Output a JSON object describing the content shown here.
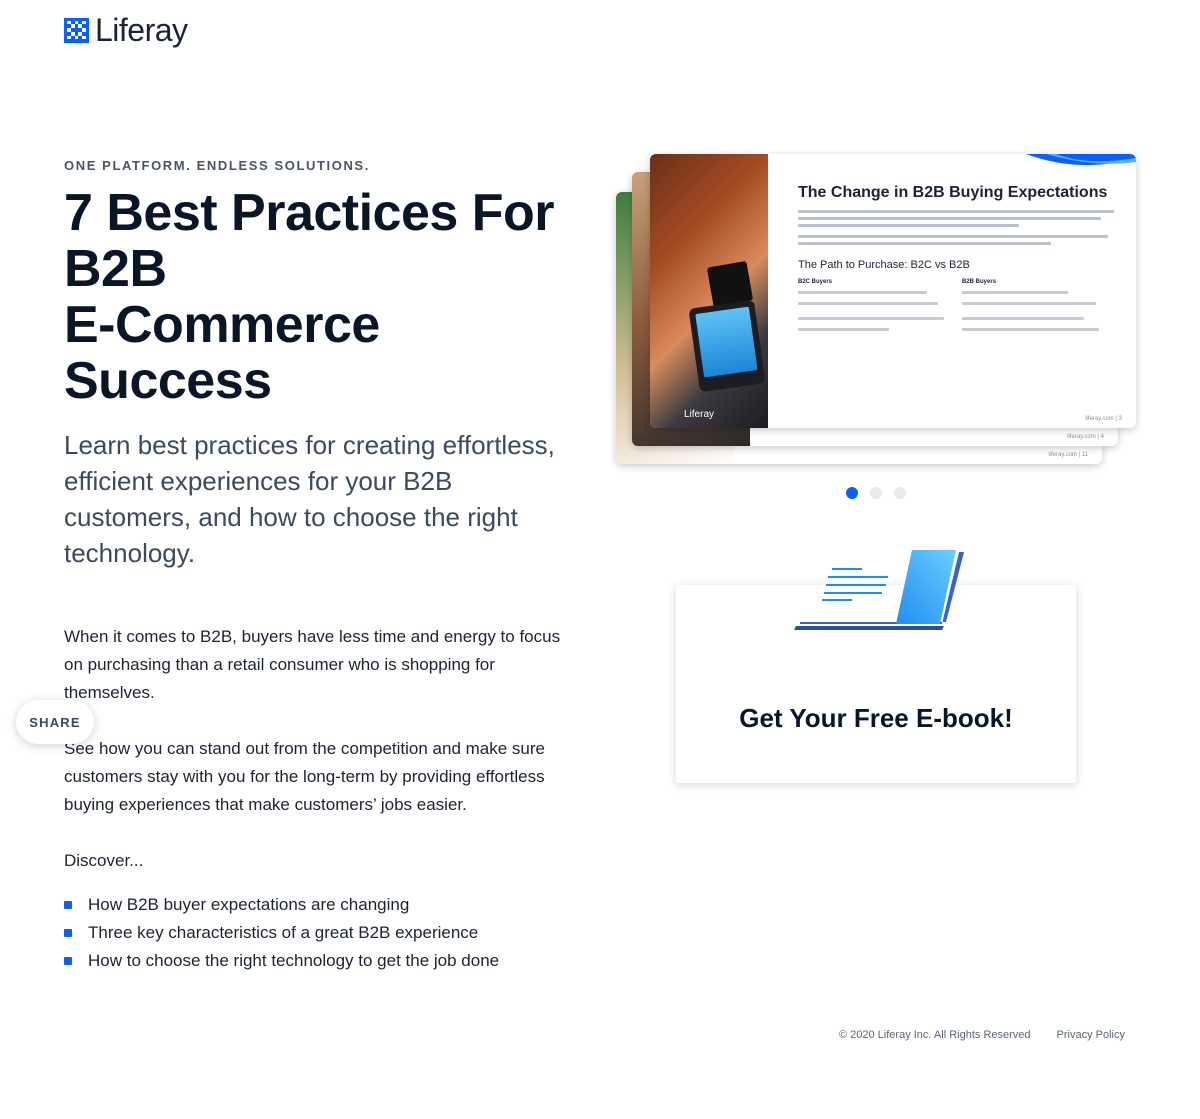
{
  "brand": {
    "name": "Liferay",
    "accent": "#0b5fff"
  },
  "hero": {
    "eyebrow": "ONE PLATFORM. ENDLESS SOLUTIONS.",
    "title": "7 Best Practices For B2B\nE-Commerce Success",
    "subtitle": "Learn best practices for creating effortless, efficient experiences for your B2B customers, and how to choose the right technology."
  },
  "body": {
    "p1": "When it comes to B2B, buyers have less time and energy to focus on purchasing than a retail consumer who is shopping for themselves.",
    "p2": "See how you can stand out from the competition and make sure customers stay with you for the long-term by providing effortless buying experiences that make customers’ jobs easier.",
    "p3": "Discover...",
    "bullets": [
      "How B2B buyer expectations are changing",
      "Three key characteristics of a great B2B experience",
      "How to choose the right technology to get the job done"
    ]
  },
  "share": {
    "label": "SHARE"
  },
  "carousel": {
    "slide_title": "The Change in B2B Buying Expectations",
    "slide_subtitle": "The Path to Purchase: B2C vs B2B",
    "col1_heading": "B2C Buyers",
    "col2_heading": "B2B Buyers",
    "photo_logo": "Liferay",
    "page_num_front": "liferay.com | 3",
    "page_num_mid": "liferay.com | 4",
    "page_num_back": "liferay.com | 11",
    "active_index": 0,
    "slide_count": 3
  },
  "ebook": {
    "cta": "Get Your Free E-book!"
  },
  "footer": {
    "copyright": "© 2020 Liferay Inc. All Rights Reserved",
    "privacy": "Privacy Policy"
  }
}
